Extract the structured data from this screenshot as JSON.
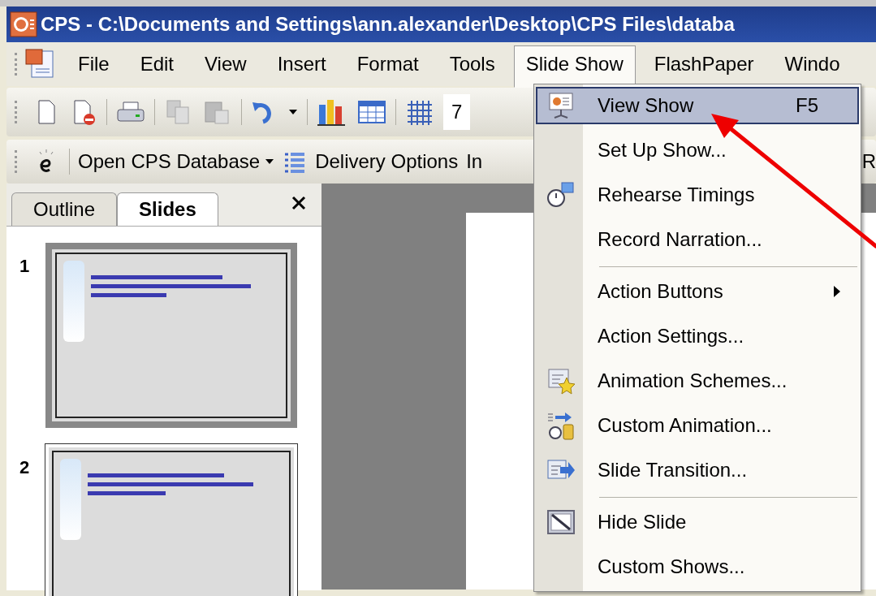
{
  "window": {
    "title": "CPS - C:\\Documents and Settings\\ann.alexander\\Desktop\\CPS Files\\databa"
  },
  "menu_bar": [
    {
      "label": "File",
      "selected": false
    },
    {
      "label": "Edit",
      "selected": false
    },
    {
      "label": "View",
      "selected": false
    },
    {
      "label": "Insert",
      "selected": false
    },
    {
      "label": "Format",
      "selected": false
    },
    {
      "label": "Tools",
      "selected": false
    },
    {
      "label": "Slide Show",
      "selected": true
    },
    {
      "label": "FlashPaper",
      "selected": false
    },
    {
      "label": "Windo",
      "selected": false
    }
  ],
  "toolbar": {
    "zoom": "7"
  },
  "cps_toolbar": [
    {
      "label": "Open CPS Database",
      "kind": "dropdown"
    },
    {
      "label": "Delivery Options",
      "kind": "icon"
    },
    {
      "label": "In",
      "kind": "plain"
    },
    {
      "label": "R",
      "kind": "end"
    }
  ],
  "panel_tabs": [
    {
      "label": "Outline",
      "selected": false
    },
    {
      "label": "Slides",
      "selected": true
    }
  ],
  "slides": [
    {
      "number": "1",
      "selected": true
    },
    {
      "number": "2",
      "selected": false
    }
  ],
  "slide_show_menu": [
    {
      "label": "View Show",
      "shortcut": "F5",
      "selected": true,
      "separator_before": false,
      "submenu": false
    },
    {
      "label": "Set Up Show...",
      "selected": false,
      "separator_before": false,
      "submenu": false
    },
    {
      "label": "Rehearse Timings",
      "selected": false,
      "separator_before": false,
      "submenu": false
    },
    {
      "label": "Record Narration...",
      "selected": false,
      "separator_before": false,
      "submenu": false
    },
    {
      "label": "Action Buttons",
      "selected": false,
      "separator_before": true,
      "submenu": true
    },
    {
      "label": "Action Settings...",
      "selected": false,
      "separator_before": false,
      "submenu": false
    },
    {
      "label": "Animation Schemes...",
      "selected": false,
      "separator_before": false,
      "submenu": false
    },
    {
      "label": "Custom Animation...",
      "selected": false,
      "separator_before": false,
      "submenu": false
    },
    {
      "label": "Slide Transition...",
      "selected": false,
      "separator_before": false,
      "submenu": false
    },
    {
      "label": "Hide Slide",
      "selected": false,
      "separator_before": true,
      "submenu": false
    },
    {
      "label": "Custom Shows...",
      "selected": false,
      "separator_before": false,
      "submenu": false
    }
  ]
}
